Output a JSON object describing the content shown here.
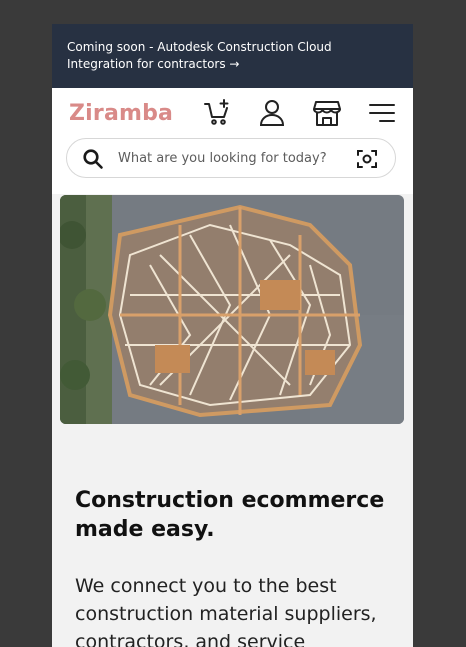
{
  "banner": {
    "text": "Coming soon - Autodesk Construction Cloud Integration for contractors →"
  },
  "header": {
    "logo": "Ziramba",
    "icons": [
      "cart-plus-icon",
      "user-icon",
      "store-icon",
      "menu-icon"
    ]
  },
  "search": {
    "placeholder": "What are you looking for today?"
  },
  "hero": {
    "image": "aerial view of house framing construction"
  },
  "content": {
    "headline": "Construction ecommerce made easy.",
    "body": "We connect you to the best construction material suppliers, contractors, and service"
  },
  "colors": {
    "banner_bg": "#273142",
    "logo": "#d98a88",
    "page_bg": "#f2f2f2",
    "outer_bg": "#3a3a3a"
  }
}
